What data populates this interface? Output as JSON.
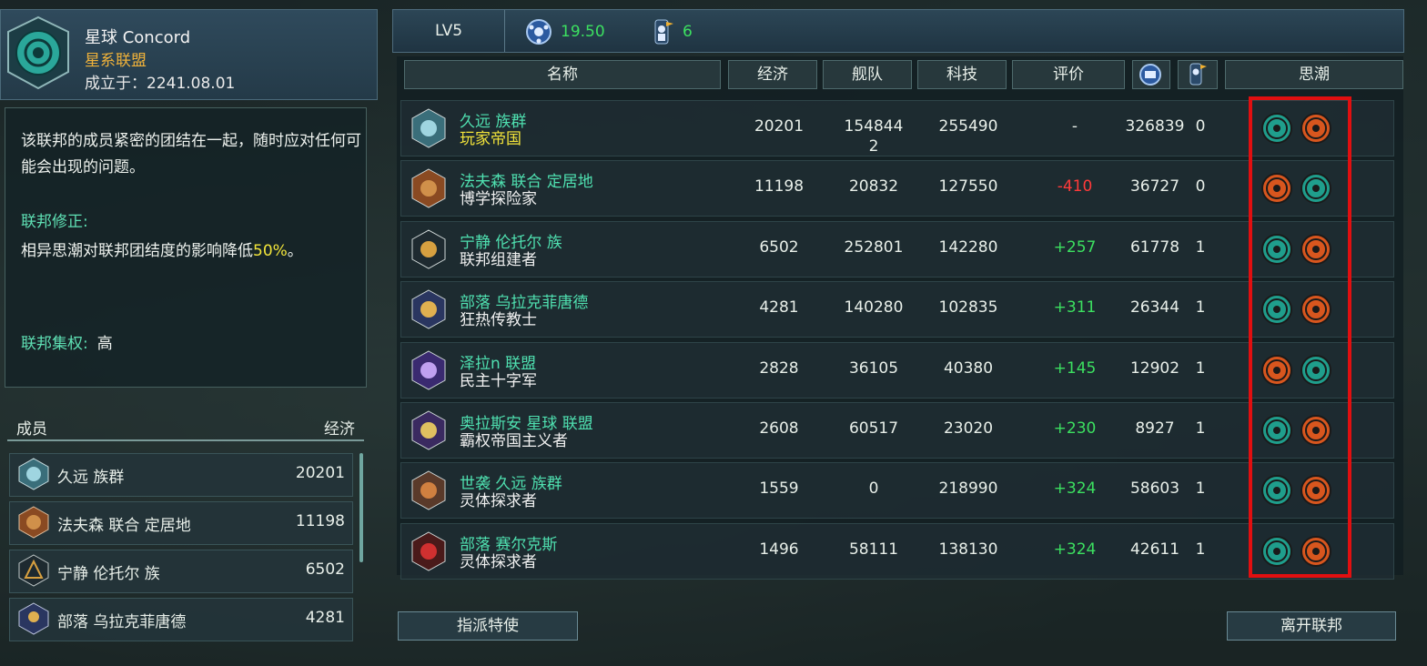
{
  "federation": {
    "name": "星球 Concord",
    "type": "星系联盟",
    "founded": "成立于：2241.08.01",
    "description": "该联邦的成员紧密的团结在一起，随时应对任何可能会出现的问题。",
    "modifier_label": "联邦修正:",
    "modifier_text": "相异思潮对联邦团结度的影响降低",
    "modifier_pct": "50%",
    "modifier_end": "。",
    "centralization_label": "联邦集权:",
    "centralization_value": "高"
  },
  "members_panel": {
    "col_member": "成员",
    "col_economy": "经济",
    "rows": [
      {
        "name": "久远 族群",
        "economy": "20201"
      },
      {
        "name": "法夫森 联合 定居地",
        "economy": "11198"
      },
      {
        "name": "宁静 伦托尔 族",
        "economy": "6502"
      },
      {
        "name": "部落 乌拉克菲唐德",
        "economy": "4281"
      }
    ]
  },
  "topbar": {
    "level": "LV5",
    "cohesion": "19.50",
    "envoys": "6"
  },
  "table": {
    "headers": {
      "name": "名称",
      "economy": "经济",
      "fleet": "舰队",
      "tech": "科技",
      "rating": "评价",
      "ethics": "思潮"
    },
    "rows": [
      {
        "name": "久远 族群",
        "subtitle": "玩家帝国",
        "economy": "20201",
        "fleet": "154844",
        "fleet2": "2",
        "tech": "255490",
        "rating": "-",
        "col6": "326839",
        "col7": "0",
        "ethics": [
          "teal-gear",
          "orange-person"
        ]
      },
      {
        "name": "法夫森 联合 定居地",
        "subtitle": "博学探险家",
        "economy": "11198",
        "fleet": "20832",
        "tech": "127550",
        "rating": "-410",
        "col6": "36727",
        "col7": "0",
        "ethics": [
          "orange-scales",
          "teal-hex"
        ]
      },
      {
        "name": "宁静 伦托尔 族",
        "subtitle": "联邦组建者",
        "economy": "6502",
        "fleet": "252801",
        "tech": "142280",
        "rating": "+257",
        "col6": "61778",
        "col7": "1",
        "ethics": [
          "teal-scales",
          "orange-peace"
        ]
      },
      {
        "name": "部落 乌拉克菲唐德",
        "subtitle": "狂热传教士",
        "economy": "4281",
        "fleet": "140280",
        "tech": "102835",
        "rating": "+311",
        "col6": "26344",
        "col7": "1",
        "ethics": [
          "teal-hands",
          "orange-person"
        ]
      },
      {
        "name": "泽拉n 联盟",
        "subtitle": "民主十字军",
        "economy": "2828",
        "fleet": "36105",
        "tech": "40380",
        "rating": "+145",
        "col6": "12902",
        "col7": "1",
        "ethics": [
          "orange-scales",
          "teal-swords"
        ]
      },
      {
        "name": "奥拉斯安 星球 联盟",
        "subtitle": "霸权帝国主义者",
        "economy": "2608",
        "fleet": "60517",
        "tech": "23020",
        "rating": "+230",
        "col6": "8927",
        "col7": "1",
        "ethics": [
          "teal-hands",
          "orange-swords"
        ]
      },
      {
        "name": "世袭 久远 族群",
        "subtitle": "灵体探求者",
        "economy": "1559",
        "fleet": "0",
        "tech": "218990",
        "rating": "+324",
        "col6": "58603",
        "col7": "1",
        "ethics": [
          "teal-atom",
          "orange-person"
        ]
      },
      {
        "name": "部落 赛尔克斯",
        "subtitle": "灵体探求者",
        "economy": "1496",
        "fleet": "58111",
        "tech": "138130",
        "rating": "+324",
        "col6": "42611",
        "col7": "1",
        "ethics": [
          "teal-atom",
          "orange-person"
        ]
      }
    ]
  },
  "buttons": {
    "send_envoy": "指派特使",
    "leave_federation": "离开联邦"
  },
  "colors": {
    "positive": "#3ce060",
    "negative": "#ff3a3a",
    "name": "#4fe0b0",
    "player": "#f2e33a",
    "highlight_box": "#e10f10"
  }
}
